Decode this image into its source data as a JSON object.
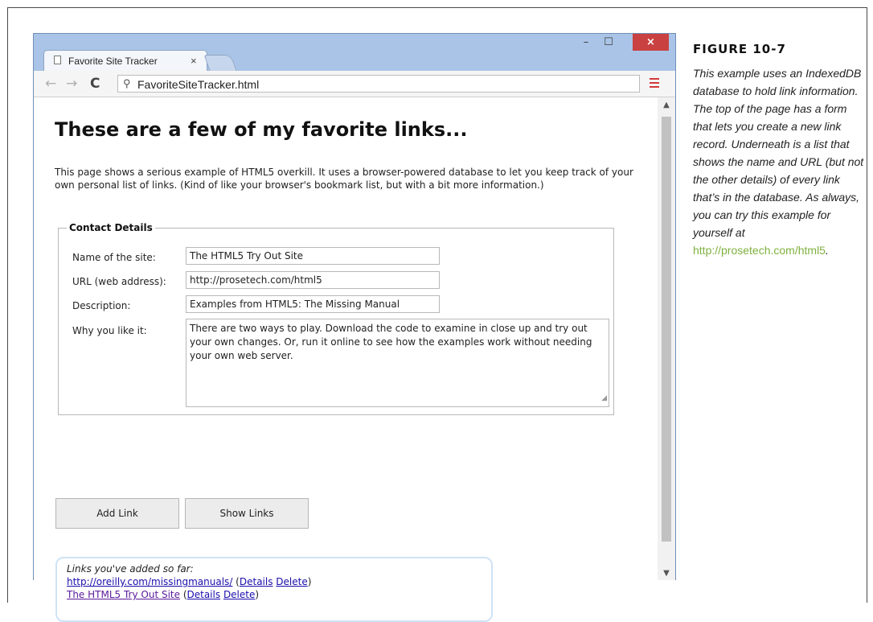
{
  "figure": {
    "title": "FIGURE 10-7",
    "caption": "This example uses an IndexedDB database to hold link information. The top of the page has a form that lets you create a new link record. Underneath is a list that shows the name and URL (but not the other details) of every link that’s in the database. As always, you can try this example for yourself at",
    "link": "http://prosetech.com/html5",
    "link_color": "#7fb13f"
  },
  "browser": {
    "tab_title": "Favorite Site Tracker",
    "tab_close": "×",
    "address": "FavoriteSiteTracker.html",
    "controls": {
      "minimize": "–",
      "maximize": "☐",
      "close": "×"
    },
    "close_color": "#c94141",
    "menu_color": "#d23b3b"
  },
  "page": {
    "heading": "These are a few of my favorite links...",
    "intro": "This page shows a serious example of HTML5 overkill. It uses a browser-powered database to let you keep track of your own personal list of links. (Kind of like your browser's bookmark list, but with a bit more information.)",
    "form": {
      "legend": "Contact Details",
      "name_label": "Name of the site:",
      "name_value": "The HTML5 Try Out Site",
      "url_label": "URL (web address):",
      "url_value": "http://prosetech.com/html5",
      "description_label": "Description:",
      "description_value": "Examples from HTML5: The Missing Manual",
      "why_label": "Why you like it:",
      "why_value": "There are two ways to play. Download the code to examine in close up and try out your own changes. Or, run it online to see how the examples work without needing your own web server."
    },
    "buttons": {
      "add": "Add Link",
      "show": "Show Links"
    },
    "links_caption": "Links you've added so far:",
    "links": [
      {
        "text": "http://oreilly.com/missingmanuals/",
        "details": "Details",
        "delete": "Delete"
      },
      {
        "text": "The HTML5 Try Out Site",
        "details": "Details",
        "delete": "Delete"
      }
    ]
  }
}
